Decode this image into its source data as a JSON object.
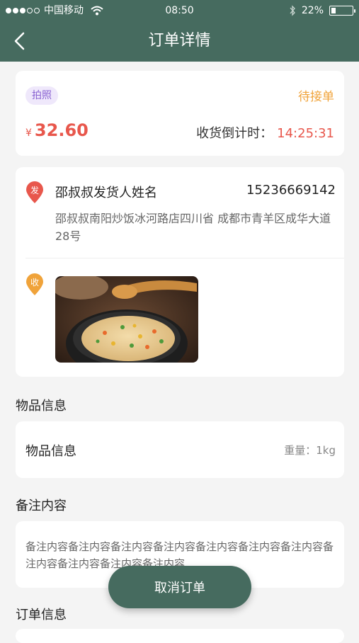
{
  "status_bar": {
    "carrier": "中国移动",
    "time": "08:50",
    "battery": "22%",
    "battery_level": 0.22
  },
  "header": {
    "title": "订单详情"
  },
  "order": {
    "tag": "拍照",
    "status": "待接单",
    "currency": "¥",
    "price": "32.60",
    "countdown_label": "收货倒计时：",
    "countdown_value": "14:25:31"
  },
  "sender": {
    "badge": "发",
    "name": "邵叔叔发货人姓名",
    "phone": "15236669142",
    "address": "邵叔叔南阳炒饭冰河路店四川省 成都市青羊区成华大道28号"
  },
  "receiver": {
    "badge": "收"
  },
  "goods_section": {
    "title": "物品信息",
    "item_label": "物品信息",
    "weight": "重量：1kg"
  },
  "remark_section": {
    "title": "备注内容",
    "text": "备注内容备注内容备注内容备注内容备注内容备注内容备注内容备注内容备注内容备注内容备注内容"
  },
  "order_info_section": {
    "title": "订单信息"
  },
  "actions": {
    "cancel_label": "取消订单"
  },
  "colors": {
    "header_bg": "#466b5f",
    "price_red": "#e8574c",
    "status_orange": "#f0a33a",
    "tag_purple": "#8a63d2"
  },
  "icons": [
    "back-icon",
    "wifi-icon",
    "bluetooth-icon",
    "battery-icon",
    "send-pin-icon",
    "receive-pin-icon"
  ]
}
